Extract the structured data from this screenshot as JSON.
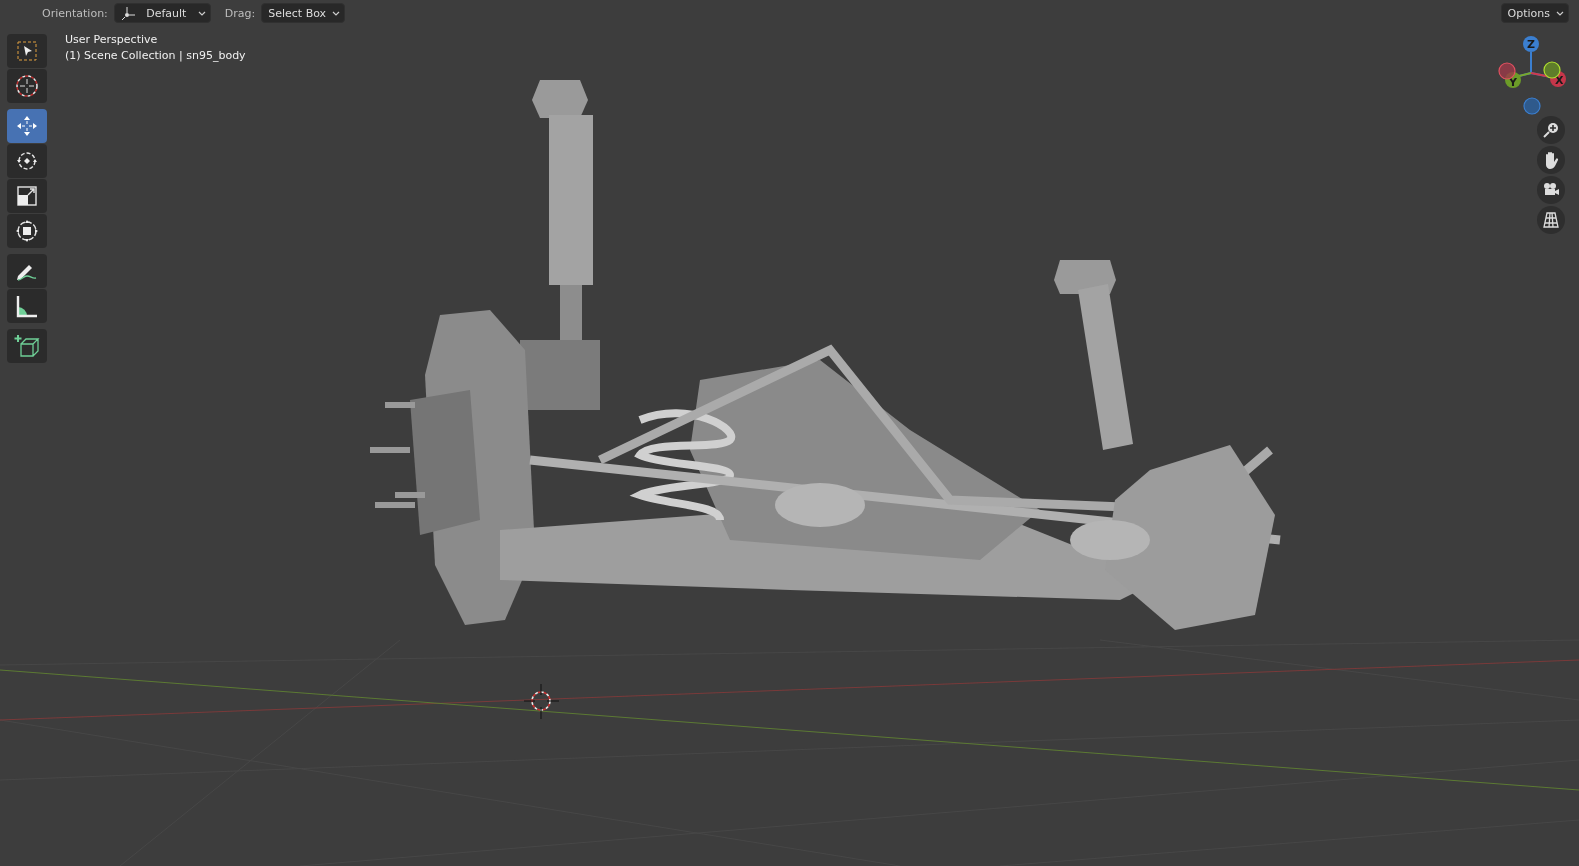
{
  "header": {
    "orientation_label": "Orientation:",
    "orientation_value": "Default",
    "drag_label": "Drag:",
    "drag_value": "Select Box",
    "options": "Options"
  },
  "viewport": {
    "view_name": "User Perspective",
    "collection_info": "(1) Scene Collection | sn95_body"
  },
  "tool_groups": [
    [
      {
        "kind": "select",
        "selected": false
      },
      {
        "kind": "cursor",
        "selected": false
      }
    ],
    [
      {
        "kind": "move",
        "selected": true
      },
      {
        "kind": "rotate",
        "selected": false
      },
      {
        "kind": "scale",
        "selected": false
      },
      {
        "kind": "transform",
        "selected": false
      }
    ],
    [
      {
        "kind": "annotate",
        "selected": false
      },
      {
        "kind": "measure",
        "selected": false
      }
    ],
    [
      {
        "kind": "add_cube",
        "selected": false
      }
    ]
  ],
  "gizmo": {
    "axis_labels": [
      "Z",
      "Y",
      "X"
    ]
  }
}
